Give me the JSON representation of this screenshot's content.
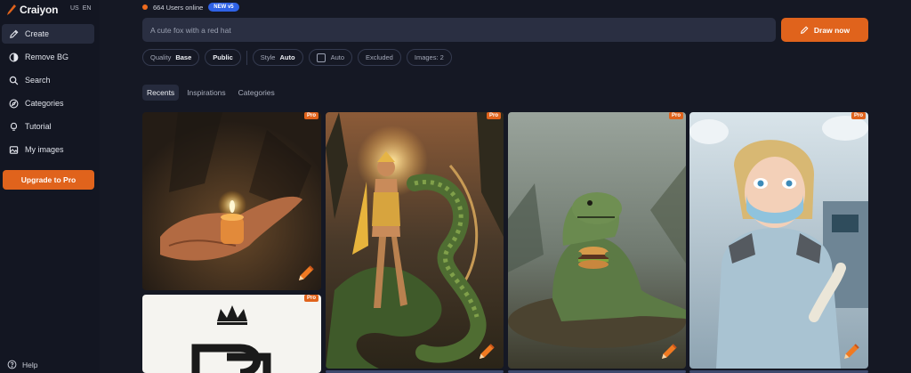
{
  "sidebar": {
    "brand": "Craiyon",
    "lang_country": "US",
    "lang_code": "EN",
    "items": [
      {
        "label": "Create"
      },
      {
        "label": "Remove BG"
      },
      {
        "label": "Search"
      },
      {
        "label": "Categories"
      },
      {
        "label": "Tutorial"
      },
      {
        "label": "My images"
      }
    ],
    "upgrade_label": "Upgrade to Pro",
    "help_label": "Help"
  },
  "status": {
    "online_text": "664 Users online",
    "badge": "NEW v5"
  },
  "prompt": {
    "placeholder": "A cute fox with a red hat",
    "value": ""
  },
  "draw_label": "Draw now",
  "options": {
    "quality_label": "Quality",
    "quality_value": "Base",
    "visibility": "Public",
    "style_label": "Style",
    "style_value": "Auto",
    "negative_label": "Auto",
    "excluded_label": "Excluded",
    "images_label": "Images: 2"
  },
  "tabs": [
    {
      "label": "Recents"
    },
    {
      "label": "Inspirations"
    },
    {
      "label": "Categories"
    }
  ],
  "gallery": {
    "pro_label": "Pro",
    "cards": [
      {
        "subject": "hand holding candle"
      },
      {
        "subject": "archer with serpent"
      },
      {
        "subject": "dinosaur with burger"
      },
      {
        "subject": "surgeon with mask"
      },
      {
        "subject": "logo with crown"
      }
    ]
  },
  "colors": {
    "accent": "#e0631c",
    "badge_blue": "#2f62e6",
    "background": "#151824"
  }
}
